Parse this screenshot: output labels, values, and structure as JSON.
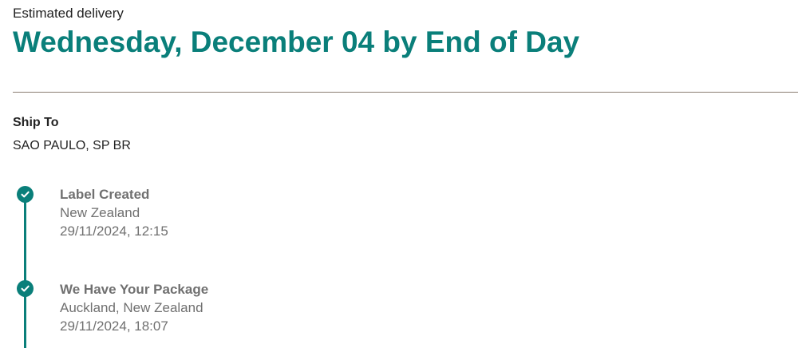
{
  "delivery": {
    "label": "Estimated delivery",
    "date": "Wednesday, December 04 by End of Day"
  },
  "ship_to": {
    "heading": "Ship To",
    "address": "SAO PAULO, SP BR"
  },
  "milestones": [
    {
      "title": "Label Created",
      "location": "New Zealand",
      "datetime": "29/11/2024, 12:15",
      "icon": "check-circle-icon"
    },
    {
      "title": "We Have Your Package",
      "location": "Auckland, New Zealand",
      "datetime": "29/11/2024, 18:07",
      "icon": "check-circle-icon"
    }
  ],
  "colors": {
    "accent": "#0a7f7a",
    "divider": "#8b7d72",
    "muted_text": "#707070",
    "primary_text": "#222222"
  }
}
